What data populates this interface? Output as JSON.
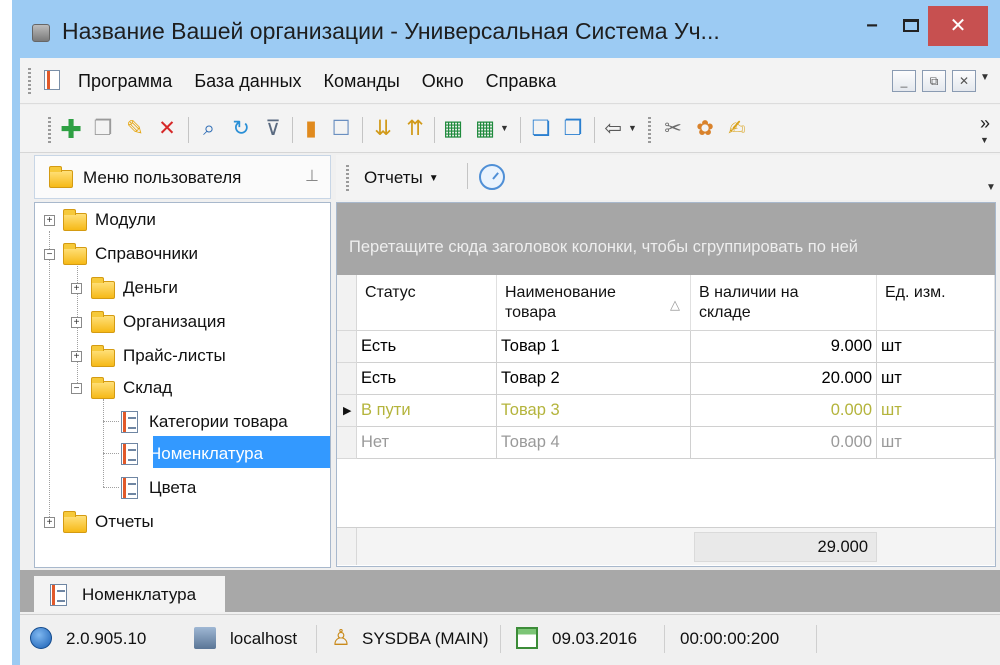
{
  "window": {
    "title": "Название Вашей организации - Универсальная Система Уч...",
    "minimize_glyph": "−",
    "close_glyph": "✕"
  },
  "menu": {
    "items": [
      "Программа",
      "База данных",
      "Команды",
      "Окно",
      "Справка"
    ],
    "mdi_buttons": [
      "_",
      "⧉",
      "✕"
    ]
  },
  "toolbar": {
    "icons": [
      "add-icon",
      "copy-icon",
      "edit-icon",
      "delete-icon",
      "search-icon",
      "refresh-icon",
      "filter-icon",
      "chart-icon",
      "comment-icon",
      "sort-down-icon",
      "sort-up-icon",
      "export-excel-icon",
      "export-excel-options-icon",
      "window-new-icon",
      "window-close-icon",
      "exit-icon",
      "tools-icon",
      "paint-icon",
      "note-edit-icon"
    ],
    "overflow_glyph": "»"
  },
  "left_panel": {
    "title": "Меню пользователя",
    "pin_glyph": "📌",
    "tree": [
      {
        "label": "Модули",
        "expander": "+"
      },
      {
        "label": "Справочники",
        "expander": "−"
      },
      {
        "label": "Деньги",
        "expander": "+"
      },
      {
        "label": "Организация",
        "expander": "+"
      },
      {
        "label": "Прайс-листы",
        "expander": "+"
      },
      {
        "label": "Склад",
        "expander": "−"
      },
      {
        "label": "Категории товара"
      },
      {
        "label": "Номенклатура",
        "selected": true
      },
      {
        "label": "Цвета"
      },
      {
        "label": "Отчеты",
        "expander": "+"
      }
    ]
  },
  "right_panel": {
    "reports_label": "Отчеты",
    "group_hint": "Перетащите сюда заголовок колонки, чтобы сгруппировать по ней",
    "columns": [
      "Статус",
      "Наименование товара",
      "В наличии на складе",
      "Ед. изм."
    ],
    "rows": [
      {
        "status": "Есть",
        "name": "Товар 1",
        "qty": "9.000",
        "unit": "шт",
        "color": "#111111"
      },
      {
        "status": "Есть",
        "name": "Товар 2",
        "qty": "20.000",
        "unit": "шт",
        "color": "#111111"
      },
      {
        "status": "В пути",
        "name": "Товар 3",
        "qty": "0.000",
        "unit": "шт",
        "color": "#b4b43c",
        "current": true
      },
      {
        "status": "Нет",
        "name": "Товар 4",
        "qty": "0.000",
        "unit": "шт",
        "color": "#9a9a9a"
      }
    ],
    "total": "29.000"
  },
  "doc_tab": {
    "label": "Номенклатура"
  },
  "statusbar": {
    "version": "2.0.905.10",
    "server": "localhost",
    "user": "SYSDBA (MAIN)",
    "date": "09.03.2016",
    "time": "00:00:00:200"
  },
  "colors": {
    "title_bg": "#9ccbf3",
    "close_bg": "#c75050",
    "selection": "#3399ff",
    "group_panel": "#a6a6a6",
    "in_transit_text": "#b4b43c",
    "absent_text": "#9a9a9a"
  }
}
